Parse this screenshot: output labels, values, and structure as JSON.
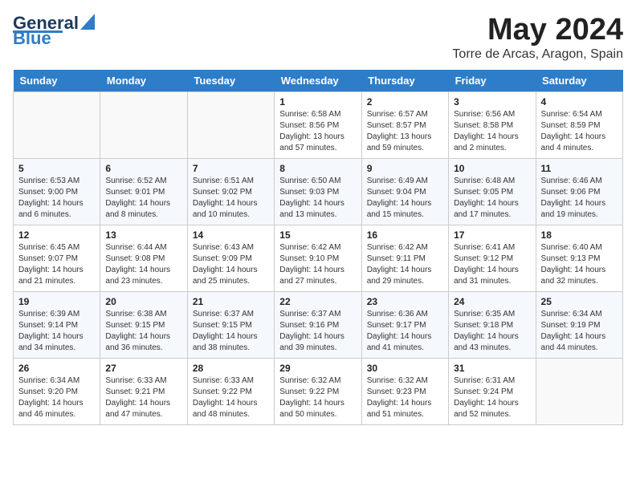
{
  "logo": {
    "line1": "General",
    "line2": "Blue"
  },
  "header": {
    "month": "May 2024",
    "location": "Torre de Arcas, Aragon, Spain"
  },
  "days_of_week": [
    "Sunday",
    "Monday",
    "Tuesday",
    "Wednesday",
    "Thursday",
    "Friday",
    "Saturday"
  ],
  "weeks": [
    [
      {
        "day": "",
        "lines": []
      },
      {
        "day": "",
        "lines": []
      },
      {
        "day": "",
        "lines": []
      },
      {
        "day": "1",
        "lines": [
          "Sunrise: 6:58 AM",
          "Sunset: 8:56 PM",
          "Daylight: 13 hours",
          "and 57 minutes."
        ]
      },
      {
        "day": "2",
        "lines": [
          "Sunrise: 6:57 AM",
          "Sunset: 8:57 PM",
          "Daylight: 13 hours",
          "and 59 minutes."
        ]
      },
      {
        "day": "3",
        "lines": [
          "Sunrise: 6:56 AM",
          "Sunset: 8:58 PM",
          "Daylight: 14 hours",
          "and 2 minutes."
        ]
      },
      {
        "day": "4",
        "lines": [
          "Sunrise: 6:54 AM",
          "Sunset: 8:59 PM",
          "Daylight: 14 hours",
          "and 4 minutes."
        ]
      }
    ],
    [
      {
        "day": "5",
        "lines": [
          "Sunrise: 6:53 AM",
          "Sunset: 9:00 PM",
          "Daylight: 14 hours",
          "and 6 minutes."
        ]
      },
      {
        "day": "6",
        "lines": [
          "Sunrise: 6:52 AM",
          "Sunset: 9:01 PM",
          "Daylight: 14 hours",
          "and 8 minutes."
        ]
      },
      {
        "day": "7",
        "lines": [
          "Sunrise: 6:51 AM",
          "Sunset: 9:02 PM",
          "Daylight: 14 hours",
          "and 10 minutes."
        ]
      },
      {
        "day": "8",
        "lines": [
          "Sunrise: 6:50 AM",
          "Sunset: 9:03 PM",
          "Daylight: 14 hours",
          "and 13 minutes."
        ]
      },
      {
        "day": "9",
        "lines": [
          "Sunrise: 6:49 AM",
          "Sunset: 9:04 PM",
          "Daylight: 14 hours",
          "and 15 minutes."
        ]
      },
      {
        "day": "10",
        "lines": [
          "Sunrise: 6:48 AM",
          "Sunset: 9:05 PM",
          "Daylight: 14 hours",
          "and 17 minutes."
        ]
      },
      {
        "day": "11",
        "lines": [
          "Sunrise: 6:46 AM",
          "Sunset: 9:06 PM",
          "Daylight: 14 hours",
          "and 19 minutes."
        ]
      }
    ],
    [
      {
        "day": "12",
        "lines": [
          "Sunrise: 6:45 AM",
          "Sunset: 9:07 PM",
          "Daylight: 14 hours",
          "and 21 minutes."
        ]
      },
      {
        "day": "13",
        "lines": [
          "Sunrise: 6:44 AM",
          "Sunset: 9:08 PM",
          "Daylight: 14 hours",
          "and 23 minutes."
        ]
      },
      {
        "day": "14",
        "lines": [
          "Sunrise: 6:43 AM",
          "Sunset: 9:09 PM",
          "Daylight: 14 hours",
          "and 25 minutes."
        ]
      },
      {
        "day": "15",
        "lines": [
          "Sunrise: 6:42 AM",
          "Sunset: 9:10 PM",
          "Daylight: 14 hours",
          "and 27 minutes."
        ]
      },
      {
        "day": "16",
        "lines": [
          "Sunrise: 6:42 AM",
          "Sunset: 9:11 PM",
          "Daylight: 14 hours",
          "and 29 minutes."
        ]
      },
      {
        "day": "17",
        "lines": [
          "Sunrise: 6:41 AM",
          "Sunset: 9:12 PM",
          "Daylight: 14 hours",
          "and 31 minutes."
        ]
      },
      {
        "day": "18",
        "lines": [
          "Sunrise: 6:40 AM",
          "Sunset: 9:13 PM",
          "Daylight: 14 hours",
          "and 32 minutes."
        ]
      }
    ],
    [
      {
        "day": "19",
        "lines": [
          "Sunrise: 6:39 AM",
          "Sunset: 9:14 PM",
          "Daylight: 14 hours",
          "and 34 minutes."
        ]
      },
      {
        "day": "20",
        "lines": [
          "Sunrise: 6:38 AM",
          "Sunset: 9:15 PM",
          "Daylight: 14 hours",
          "and 36 minutes."
        ]
      },
      {
        "day": "21",
        "lines": [
          "Sunrise: 6:37 AM",
          "Sunset: 9:15 PM",
          "Daylight: 14 hours",
          "and 38 minutes."
        ]
      },
      {
        "day": "22",
        "lines": [
          "Sunrise: 6:37 AM",
          "Sunset: 9:16 PM",
          "Daylight: 14 hours",
          "and 39 minutes."
        ]
      },
      {
        "day": "23",
        "lines": [
          "Sunrise: 6:36 AM",
          "Sunset: 9:17 PM",
          "Daylight: 14 hours",
          "and 41 minutes."
        ]
      },
      {
        "day": "24",
        "lines": [
          "Sunrise: 6:35 AM",
          "Sunset: 9:18 PM",
          "Daylight: 14 hours",
          "and 43 minutes."
        ]
      },
      {
        "day": "25",
        "lines": [
          "Sunrise: 6:34 AM",
          "Sunset: 9:19 PM",
          "Daylight: 14 hours",
          "and 44 minutes."
        ]
      }
    ],
    [
      {
        "day": "26",
        "lines": [
          "Sunrise: 6:34 AM",
          "Sunset: 9:20 PM",
          "Daylight: 14 hours",
          "and 46 minutes."
        ]
      },
      {
        "day": "27",
        "lines": [
          "Sunrise: 6:33 AM",
          "Sunset: 9:21 PM",
          "Daylight: 14 hours",
          "and 47 minutes."
        ]
      },
      {
        "day": "28",
        "lines": [
          "Sunrise: 6:33 AM",
          "Sunset: 9:22 PM",
          "Daylight: 14 hours",
          "and 48 minutes."
        ]
      },
      {
        "day": "29",
        "lines": [
          "Sunrise: 6:32 AM",
          "Sunset: 9:22 PM",
          "Daylight: 14 hours",
          "and 50 minutes."
        ]
      },
      {
        "day": "30",
        "lines": [
          "Sunrise: 6:32 AM",
          "Sunset: 9:23 PM",
          "Daylight: 14 hours",
          "and 51 minutes."
        ]
      },
      {
        "day": "31",
        "lines": [
          "Sunrise: 6:31 AM",
          "Sunset: 9:24 PM",
          "Daylight: 14 hours",
          "and 52 minutes."
        ]
      },
      {
        "day": "",
        "lines": []
      }
    ]
  ]
}
